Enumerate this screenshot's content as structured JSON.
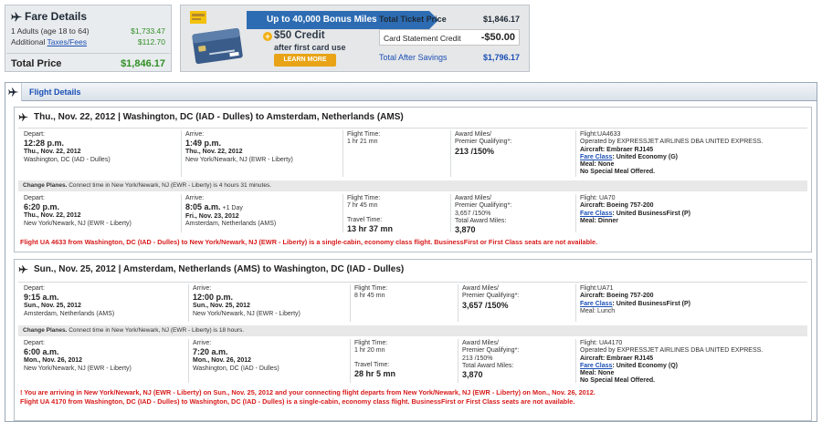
{
  "fare": {
    "title": "Fare Details",
    "adults_label": "1 Adults (age 18 to 64)",
    "adults_amount": "$1,733.47",
    "additional_prefix": "Additional ",
    "taxes_link": "Taxes/Fees",
    "taxes_amount": "$112.70",
    "total_label": "Total Price",
    "total_amount": "$1,846.17"
  },
  "promo": {
    "banner": "Up to 40,000 Bonus Miles",
    "credit": "$50 Credit",
    "credit_sub": "after first card use",
    "learn_more": "LEARN MORE",
    "total_label": "Total Ticket Price",
    "total_amount": "$1,846.17",
    "credit_label": "Card Statement Credit",
    "credit_amount": "-$50.00",
    "savings_label": "Total After Savings",
    "savings_amount": "$1,796.17"
  },
  "flight_details": {
    "title": "Flight Details"
  },
  "trip1": {
    "header": "Thu., Nov. 22, 2012 | Washington, DC (IAD - Dulles) to Amsterdam, Netherlands (AMS)",
    "seg1": {
      "depart_label": "Depart:",
      "depart_time": "12:28 p.m.",
      "depart_date": "Thu., Nov. 22, 2012",
      "depart_place": "Washington, DC (IAD - Dulles)",
      "arrive_label": "Arrive:",
      "arrive_time": "1:49 p.m.",
      "arrive_date": "Thu., Nov. 22, 2012",
      "arrive_place": "New York/Newark, NJ (EWR - Liberty)",
      "ft_label": "Flight Time:",
      "ft_value": "1 hr 21 mn",
      "award_label": "Award Miles/",
      "pq_label": "Premier Qualifying*:",
      "award_value": "213 /150%",
      "flight": "Flight:UA4633",
      "operated": "Operated by EXPRESSJET AIRLINES DBA UNITED EXPRESS.",
      "aircraft": "Aircraft: Embraer RJ145",
      "fare_class_link": "Fare Class",
      "fare_class": ": United Economy (G)",
      "meal": "Meal: None",
      "special_meal": "No Special Meal Offered."
    },
    "change_bold": "Change Planes.",
    "change_text": " Connect time in New York/Newark, NJ (EWR - Liberty) is 4 hours 31 minutes.",
    "seg2": {
      "depart_label": "Depart:",
      "depart_time": "6:20 p.m.",
      "depart_date": "Thu., Nov. 22, 2012",
      "depart_place": "New York/Newark, NJ (EWR - Liberty)",
      "arrive_label": "Arrive:",
      "arrive_time": "8:05 a.m.",
      "arrive_plus": " +1 Day",
      "arrive_date": "Fri., Nov. 23, 2012",
      "arrive_place": "Amsterdam, Netherlands (AMS)",
      "ft_label": "Flight Time:",
      "ft_value": "7 hr 45 mn",
      "travel_label": "Travel Time:",
      "travel_value": "13 hr 37 mn",
      "award_label": "Award Miles/",
      "pq_label": "Premier Qualifying*:",
      "award_value": "3,657 /150%",
      "total_award_label": "Total Award Miles:",
      "total_award_value": "3,870",
      "flight": "Flight: UA70",
      "aircraft": "Aircraft: Boeing 757-200",
      "fare_class_link": "Fare Class",
      "fare_class": ": United BusinessFirst (P)",
      "meal": "Meal: Dinner"
    },
    "warning": "Flight UA 4633 from Washington, DC (IAD - Dulles) to New York/Newark, NJ (EWR - Liberty) is a single-cabin, economy class flight. BusinessFirst or First Class seats are not available."
  },
  "trip2": {
    "header": "Sun., Nov. 25, 2012 | Amsterdam, Netherlands (AMS) to Washington, DC (IAD - Dulles)",
    "seg1": {
      "depart_label": "Depart:",
      "depart_time": "9:15 a.m.",
      "depart_date": "Sun., Nov. 25, 2012",
      "depart_place": "Amsterdam, Netherlands (AMS)",
      "arrive_label": "Arrive:",
      "arrive_time": "12:00 p.m.",
      "arrive_date": "Sun., Nov. 25, 2012",
      "arrive_place": "New York/Newark, NJ (EWR - Liberty)",
      "ft_label": "Flight Time:",
      "ft_value": "8 hr 45 mn",
      "award_label": "Award Miles/",
      "pq_label": "Premier Qualifying*:",
      "award_value": "3,657 /150%",
      "flight": "Flight:UA71",
      "aircraft": "Aircraft: Boeing 757-200",
      "fare_class_link": "Fare Class",
      "fare_class": ": United BusinessFirst (P)",
      "meal": "Meal: Lunch"
    },
    "change_bold": "Change Planes.",
    "change_text": " Connect time in New York/Newark, NJ (EWR - Liberty) is 18 hours.",
    "seg2": {
      "depart_label": "Depart:",
      "depart_time": "6:00 a.m.",
      "depart_date": "Mon., Nov. 26, 2012",
      "depart_place": "New York/Newark, NJ (EWR - Liberty)",
      "arrive_label": "Arrive:",
      "arrive_time": "7:20 a.m.",
      "arrive_date": "Mon., Nov. 26, 2012",
      "arrive_place": "Washington, DC (IAD - Dulles)",
      "ft_label": "Flight Time:",
      "ft_value": "1 hr 20 mn",
      "travel_label": "Travel Time:",
      "travel_value": "28 hr 5 mn",
      "award_label": "Award Miles/",
      "pq_label": "Premier Qualifying*:",
      "award_value": "213 /150%",
      "total_award_label": "Total Award Miles:",
      "total_award_value": "3,870",
      "flight": "Flight: UA4170",
      "operated": "Operated by EXPRESSJET AIRLINES DBA UNITED EXPRESS.",
      "aircraft": "Aircraft: Embraer RJ145",
      "fare_class_link": "Fare Class",
      "fare_class": ": United Economy (Q)",
      "meal": "Meal: None",
      "special_meal": "No Special Meal Offered."
    },
    "warning1": "! You are arriving in New York/Newark, NJ (EWR - Liberty) on Sun., Nov. 25, 2012 and your connecting flight departs from New York/Newark, NJ (EWR - Liberty) on Mon., Nov. 26, 2012.",
    "warning2": "Flight UA 4170 from Washington, DC (IAD - Dulles) to Washington, DC (IAD - Dulles) is a single-cabin, economy class flight. BusinessFirst or First Class seats are not available."
  }
}
